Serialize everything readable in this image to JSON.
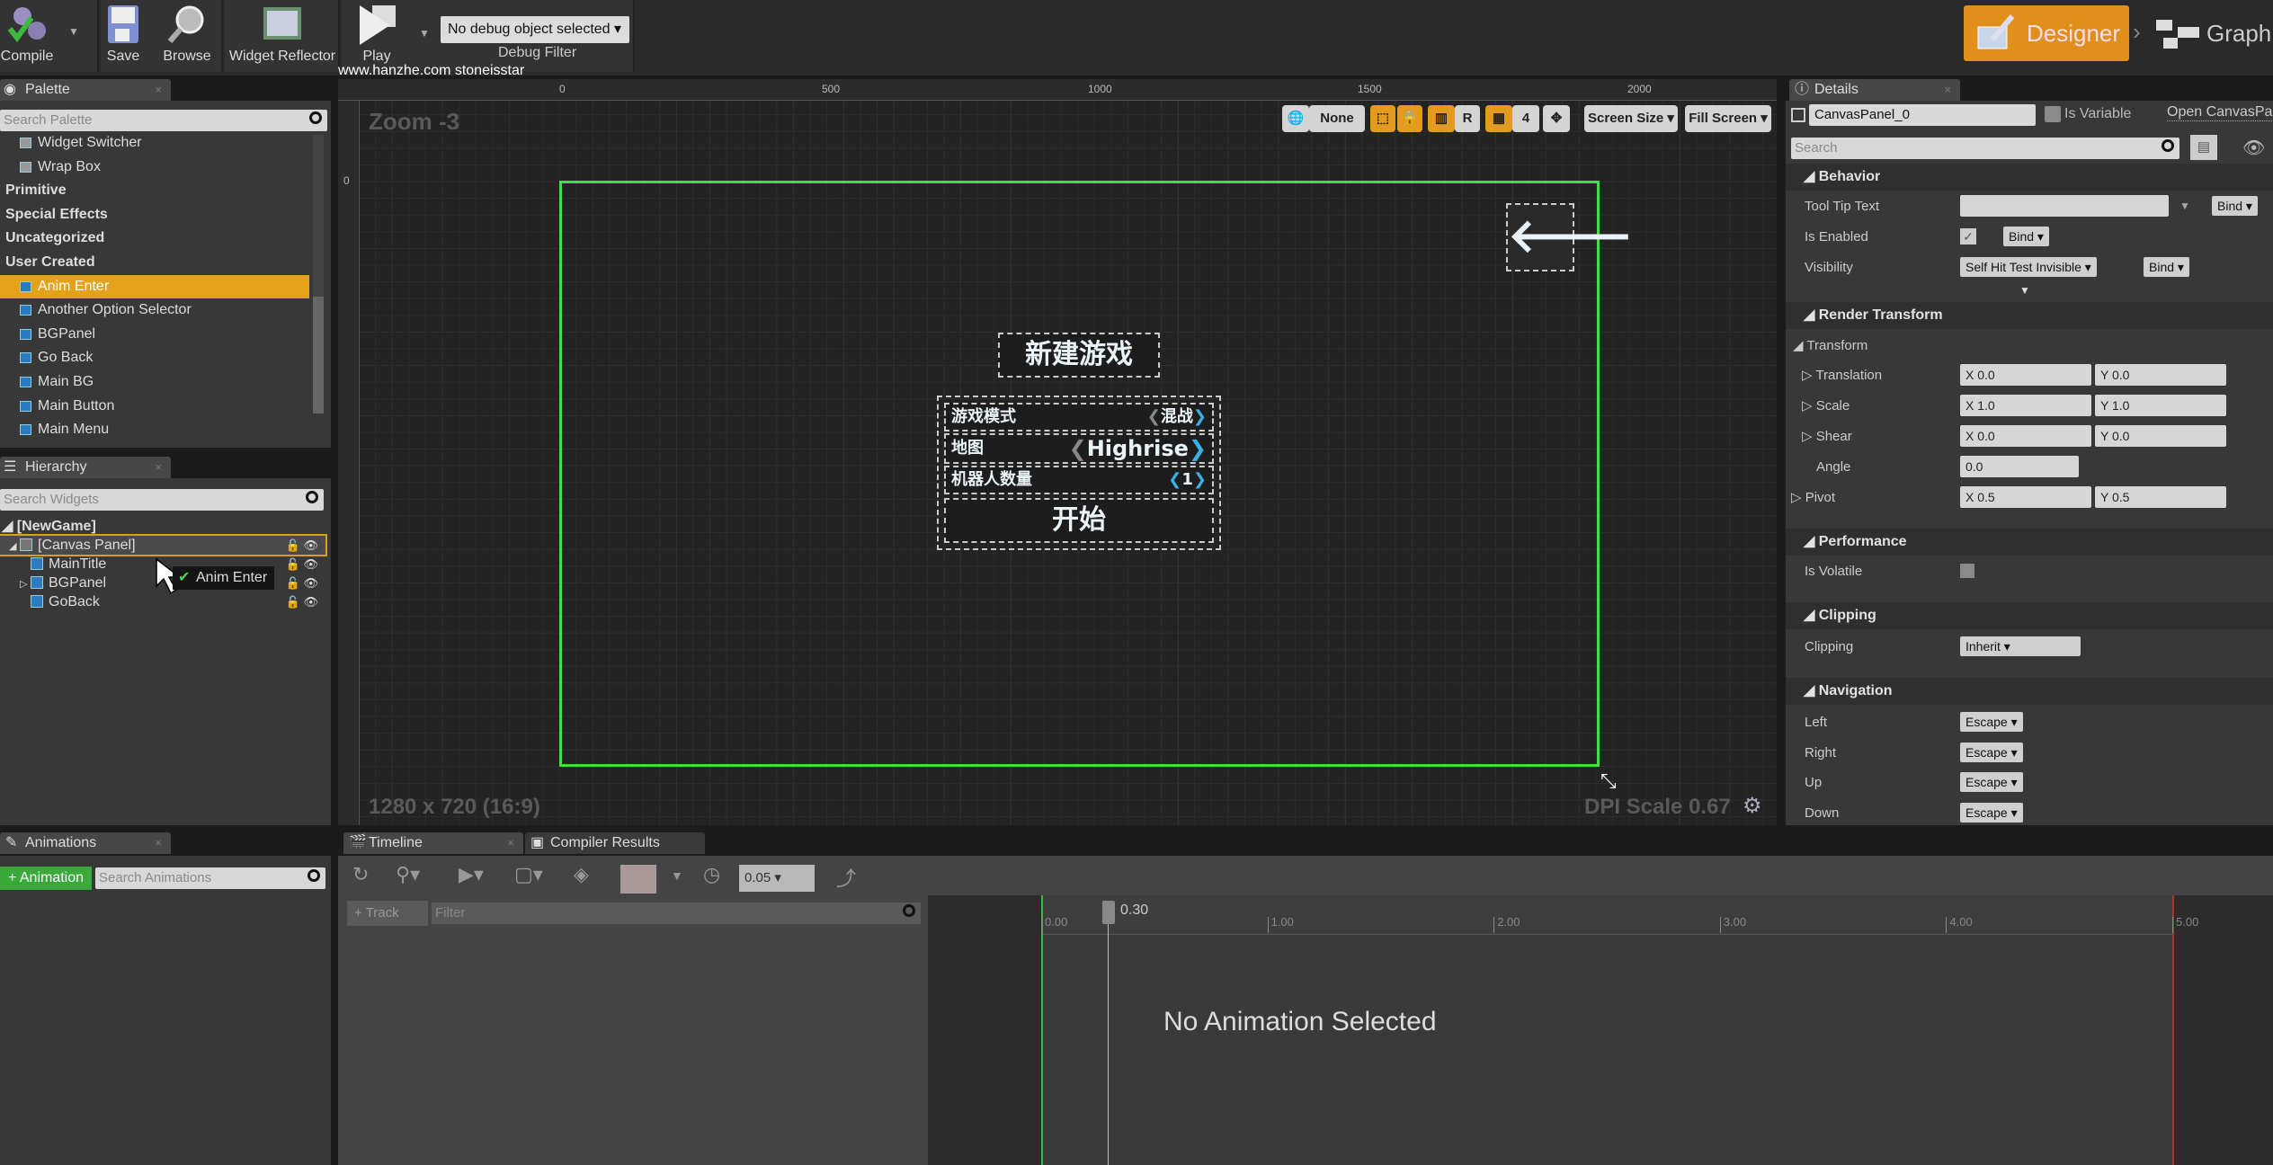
{
  "toolbar": {
    "compile": "Compile",
    "save": "Save",
    "browse": "Browse",
    "widget_reflector": "Widget Reflector",
    "play": "Play",
    "debug_select": "No debug object selected",
    "debug_filter": "Debug Filter",
    "watermark": "www.hanzhe.com stoneisstar"
  },
  "modes": {
    "designer": "Designer",
    "graph": "Graph"
  },
  "palette": {
    "tab": "Palette",
    "search_placeholder": "Search Palette",
    "items": [
      {
        "label": "Widget Switcher",
        "kind": "w",
        "icon": "widget-switcher-icon"
      },
      {
        "label": "Wrap Box",
        "kind": "w",
        "icon": "wrap-box-icon"
      },
      {
        "label": "Primitive",
        "kind": "cat"
      },
      {
        "label": "Special Effects",
        "kind": "cat"
      },
      {
        "label": "Uncategorized",
        "kind": "cat"
      },
      {
        "label": "User Created",
        "kind": "cat"
      },
      {
        "label": "Anim Enter",
        "kind": "w",
        "selected": true
      },
      {
        "label": "Another Option Selector",
        "kind": "w"
      },
      {
        "label": "BGPanel",
        "kind": "w"
      },
      {
        "label": "Go Back",
        "kind": "w"
      },
      {
        "label": "Main BG",
        "kind": "w"
      },
      {
        "label": "Main Button",
        "kind": "w"
      },
      {
        "label": "Main Menu",
        "kind": "w"
      }
    ]
  },
  "hierarchy": {
    "tab": "Hierarchy",
    "search_placeholder": "Search Widgets",
    "root": "[NewGame]",
    "items": [
      {
        "label": "[Canvas Panel]",
        "depth": 1,
        "selected": true
      },
      {
        "label": "MainTitle",
        "depth": 2
      },
      {
        "label": "BGPanel",
        "depth": 2,
        "expandable": true
      },
      {
        "label": "GoBack",
        "depth": 2
      }
    ],
    "drag_tooltip": "Anim Enter"
  },
  "viewport": {
    "zoom": "Zoom -3",
    "ruler_labels": [
      "0",
      "500",
      "1000",
      "1500",
      "2000"
    ],
    "tools": {
      "none": "None",
      "r": "R",
      "grid": "4",
      "screen_size": "Screen Size",
      "fill_screen": "Fill Screen"
    },
    "resolution": "1280 x 720 (16:9)",
    "dpi": "DPI Scale 0.67",
    "canvas_border_color": "#3ee23e",
    "game_ui": {
      "title": "新建游戏",
      "rows": [
        {
          "label": "游戏模式",
          "value": "混战"
        },
        {
          "label": "地图",
          "value": "Highrise"
        },
        {
          "label": "机器人数量",
          "value": "1"
        }
      ],
      "start": "开始",
      "back_icon": "arrow-left-icon"
    }
  },
  "details": {
    "tab": "Details",
    "name": "CanvasPanel_0",
    "is_variable": "Is Variable",
    "is_variable_checked": false,
    "open_link": "Open CanvasPa",
    "search_placeholder": "Search",
    "behavior": {
      "header": "Behavior",
      "tooltip": "Tool Tip Text",
      "enabled": "Is Enabled",
      "enabled_checked": true,
      "visibility": "Visibility",
      "visibility_value": "Self Hit Test Invisible",
      "bind": "Bind"
    },
    "render": {
      "header": "Render Transform",
      "transform": "Transform",
      "translation": "Translation",
      "tx": "0.0",
      "ty": "0.0",
      "scale": "Scale",
      "sx": "1.0",
      "sy": "1.0",
      "shear": "Shear",
      "hx": "0.0",
      "hy": "0.0",
      "angle": "Angle",
      "angle_value": "0.0",
      "pivot": "Pivot",
      "px": "0.5",
      "py": "0.5"
    },
    "performance": {
      "header": "Performance",
      "volatile": "Is Volatile",
      "volatile_checked": false
    },
    "clipping": {
      "header": "Clipping",
      "label": "Clipping",
      "value": "Inherit"
    },
    "navigation": {
      "header": "Navigation",
      "rows": [
        {
          "label": "Left",
          "value": "Escape"
        },
        {
          "label": "Right",
          "value": "Escape"
        },
        {
          "label": "Up",
          "value": "Escape"
        },
        {
          "label": "Down",
          "value": "Escape"
        }
      ]
    }
  },
  "animations": {
    "tab": "Animations",
    "add": "+ Animation",
    "search_placeholder": "Search Animations"
  },
  "timeline": {
    "tabs": [
      "Timeline",
      "Compiler Results"
    ],
    "snap": "0.05",
    "track": "+ Track",
    "filter_placeholder": "Filter",
    "playhead": "0.30",
    "ticks": [
      "0.00",
      "1.00",
      "2.00",
      "3.00",
      "4.00",
      "5.00"
    ],
    "empty": "No Animation Selected"
  }
}
